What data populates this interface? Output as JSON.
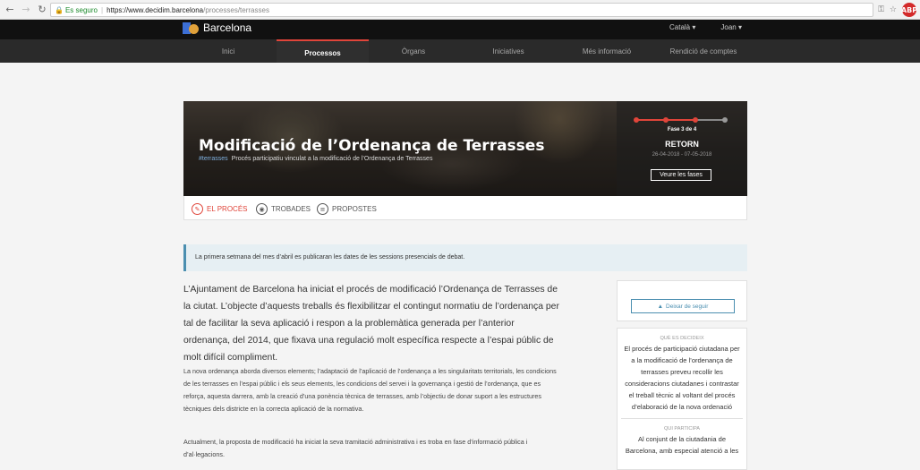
{
  "browser": {
    "secure_label": "Es seguro",
    "url_host": "https://www.decidim.barcelona",
    "url_path": "/processes/terrasses",
    "extension_label": "ABP"
  },
  "site": {
    "logo_text": "Barcelona",
    "topbar_right": [
      "Català ▾",
      "Joan ▾"
    ],
    "nav": [
      "Inici",
      "Processos",
      "Òrgans",
      "Iniciatives",
      "Més informació",
      "Rendició de comptes"
    ],
    "active_nav_index": 1,
    "accent_color": "#e0453a"
  },
  "hero": {
    "title": "Modificació de l’Ordenança de Terrasses",
    "hashtag": "#terrasses",
    "subtitle": "Procés participatiu vinculat a la modificació de l’Ordenança de Terrasses",
    "phase_label": "Fase 3 de 4",
    "phase_name": "RETORN",
    "phase_dates": "26-04-2018 - 07-05-2018",
    "phase_button": "Veure les fases"
  },
  "tabs": [
    {
      "label": "EL PROCÉS",
      "icon": "process-icon",
      "active": true
    },
    {
      "label": "TROBADES",
      "icon": "meetings-icon",
      "active": false
    },
    {
      "label": "PROPOSTES",
      "icon": "proposals-icon",
      "active": false
    }
  ],
  "announcement": "La primera setmana del mes d’abril es publicaran les dates de les sessions presencials de debat.",
  "content": {
    "lead": "L’Ajuntament de Barcelona ha iniciat el procés de modificació l’Ordenança de Terrasses de la ciutat. L’objecte d’aquests treballs és flexibilitzar el contingut normatiu de l’ordenança per tal de facilitar la seva aplicació i respon a la problemàtica generada per l’anterior ordenança, del 2014, que fixava una regulació molt específica respecte a l’espai públic de molt difícil compliment.",
    "para1": "La nova ordenança aborda diversos elements; l’adaptació de l’aplicació de l’ordenança a les singularitats territorials, les condicions de les terrasses en l’espai públic i els seus elements, les condicions del servei i la governança i gestió de l’ordenança, que es reforça, aquesta darrera, amb la creació d’una ponència tècnica de terrasses, amb l’objectiu de donar suport a les estructures tècniques dels districte en la correcta aplicació de la normativa.",
    "para2": "Actualment, la proposta de modificació ha iniciat la seva tramitació administrativa i es troba en fase d’informació pública i d’al·legacions."
  },
  "sidebar": {
    "follow_button": "Deixar de seguir",
    "what_heading": "QUÈ ES DECIDEIX",
    "what_text": "El procés de participació ciutadana per a la modificació de l’ordenança de terrasses preveu recollir les consideracions ciutadanes i contrastar el treball tècnic al voltant del procés d’elaboració de la nova ordenació",
    "who_heading": "QUI PARTICIPA",
    "who_text": "Al conjunt de la ciutadania de Barcelona, amb especial atenció a les"
  }
}
